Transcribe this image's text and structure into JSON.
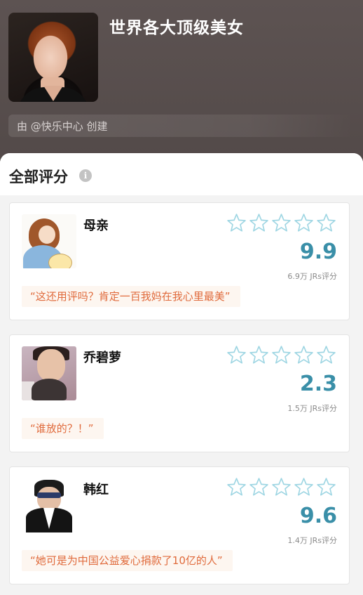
{
  "header": {
    "title": "世界各大顶级美女",
    "creator": "由 @快乐中心 创建",
    "cover_icon": "woman-portrait"
  },
  "panel": {
    "title": "全部评分",
    "info_icon": "info-icon"
  },
  "colors": {
    "accent": "#3a8fa8",
    "quote": "#e06a3b",
    "star_outline": "#9fd6e3"
  },
  "ratings": [
    {
      "name": "母亲",
      "score": "9.9",
      "stars_filled": 0,
      "count": "6.9万 JRs评分",
      "quote": "“这还用评吗？肯定一百我妈在我心里最美”",
      "avatar": "mother-cartoon"
    },
    {
      "name": "乔碧萝",
      "score": "2.3",
      "stars_filled": 0,
      "count": "1.5万 JRs评分",
      "quote": "“谁放的？！”",
      "avatar": "woman-photo"
    },
    {
      "name": "韩红",
      "score": "9.6",
      "stars_filled": 0,
      "count": "1.4万 JRs评分",
      "quote": "“她可是为中国公益爱心捐款了10亿的人”",
      "avatar": "singer-photo"
    }
  ]
}
